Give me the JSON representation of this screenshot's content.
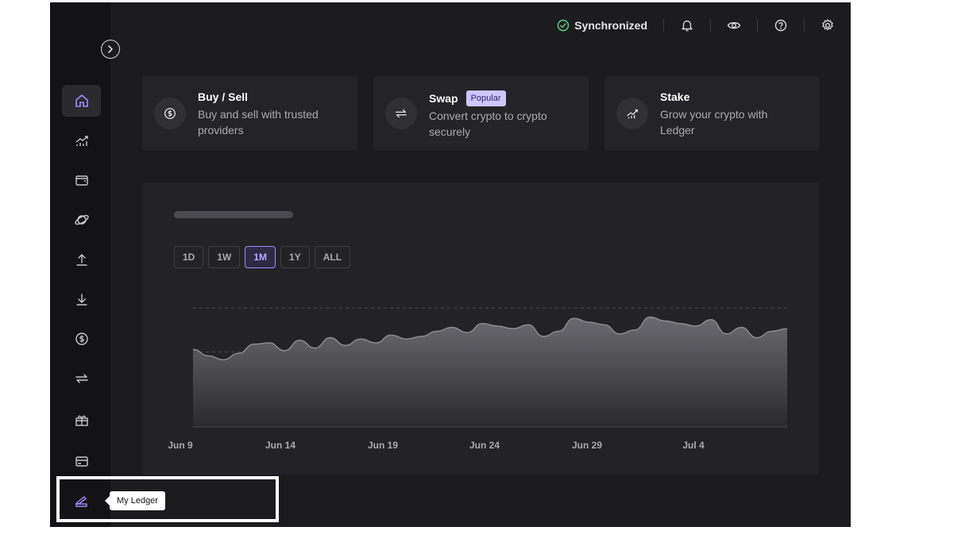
{
  "topbar": {
    "sync_label": "Synchronized",
    "icons": [
      "bell-icon",
      "eye-icon",
      "help-icon",
      "gear-icon"
    ]
  },
  "sidebar": {
    "items": [
      {
        "name": "home",
        "icon": "home-icon",
        "active": true
      },
      {
        "name": "market",
        "icon": "chart-icon"
      },
      {
        "name": "accounts",
        "icon": "wallet-icon"
      },
      {
        "name": "discover",
        "icon": "planet-icon"
      },
      {
        "name": "send",
        "icon": "upload-icon"
      },
      {
        "name": "receive",
        "icon": "download-icon"
      },
      {
        "name": "buy-sell",
        "icon": "dollar-icon"
      },
      {
        "name": "swap",
        "icon": "swap-icon"
      },
      {
        "name": "earn",
        "icon": "gift-icon"
      },
      {
        "name": "card",
        "icon": "card-icon"
      },
      {
        "name": "my-ledger",
        "icon": "ledger-icon"
      }
    ],
    "tooltip": "My Ledger"
  },
  "cards": [
    {
      "title": "Buy / Sell",
      "desc": "Buy and sell with trusted providers",
      "icon": "dollar-icon"
    },
    {
      "title": "Swap",
      "badge": "Popular",
      "desc": "Convert crypto to crypto securely",
      "icon": "swap-icon"
    },
    {
      "title": "Stake",
      "desc": "Grow your crypto with Ledger",
      "icon": "stake-icon"
    }
  ],
  "ranges": [
    "1D",
    "1W",
    "1M",
    "1Y",
    "ALL"
  ],
  "selected_range": "1M",
  "chart_data": {
    "type": "area",
    "x_tick_labels": [
      "Jun 9",
      "Jun 14",
      "Jun 19",
      "Jun 24",
      "Jun 29",
      "Jul 4"
    ],
    "values": [
      0.6,
      0.55,
      0.52,
      0.57,
      0.64,
      0.65,
      0.59,
      0.67,
      0.61,
      0.69,
      0.63,
      0.68,
      0.65,
      0.71,
      0.68,
      0.7,
      0.74,
      0.77,
      0.73,
      0.8,
      0.78,
      0.76,
      0.79,
      0.7,
      0.74,
      0.84,
      0.81,
      0.79,
      0.72,
      0.75,
      0.85,
      0.82,
      0.8,
      0.78,
      0.83,
      0.72,
      0.77,
      0.69,
      0.74,
      0.76
    ],
    "grid": true,
    "colors": {
      "accent": "#a48cff",
      "line": "#8a8a8f"
    }
  }
}
